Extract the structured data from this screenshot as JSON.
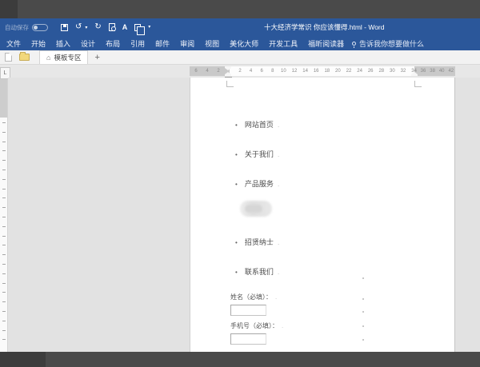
{
  "colors": {
    "titlebar_blue": "#2b579a",
    "desktop_gray": "#4a4a4a",
    "page_white": "#ffffff"
  },
  "titlebar": {
    "autosave_label": "自动保存",
    "autosave_state": "off",
    "title": "十大经济学常识 你应该懂得.html - Word",
    "undo_glyph": "↺",
    "redo_glyph": "↻",
    "more_glyph": "▾",
    "undo_caret_glyph": "▾"
  },
  "ribbon": {
    "tabs": [
      "文件",
      "开始",
      "插入",
      "设计",
      "布局",
      "引用",
      "邮件",
      "审阅",
      "视图",
      "美化大师",
      "开发工具",
      "福昕阅读器"
    ],
    "tell_me": "告诉我你想要做什么"
  },
  "doc_tab_bar": {
    "home_glyph": "⌂",
    "active_tab": "模板专区",
    "new_tab_label": "+"
  },
  "ruler": {
    "selector_glyph": "L",
    "left_numbers": [
      "6",
      "4",
      "2"
    ],
    "numbers": [
      "2",
      "4",
      "6",
      "8",
      "10",
      "12",
      "14",
      "16",
      "18",
      "20",
      "22",
      "24",
      "26",
      "28",
      "30",
      "32",
      "34"
    ],
    "right_numbers": [
      "36",
      "38",
      "40",
      "42"
    ]
  },
  "document": {
    "list_items": [
      "网站首页",
      "关于我们",
      "产品服务",
      "招贤纳士",
      "联系我们"
    ],
    "form_fields": [
      {
        "label": "姓名（必填）："
      },
      {
        "label": "手机号（必填）："
      }
    ]
  }
}
